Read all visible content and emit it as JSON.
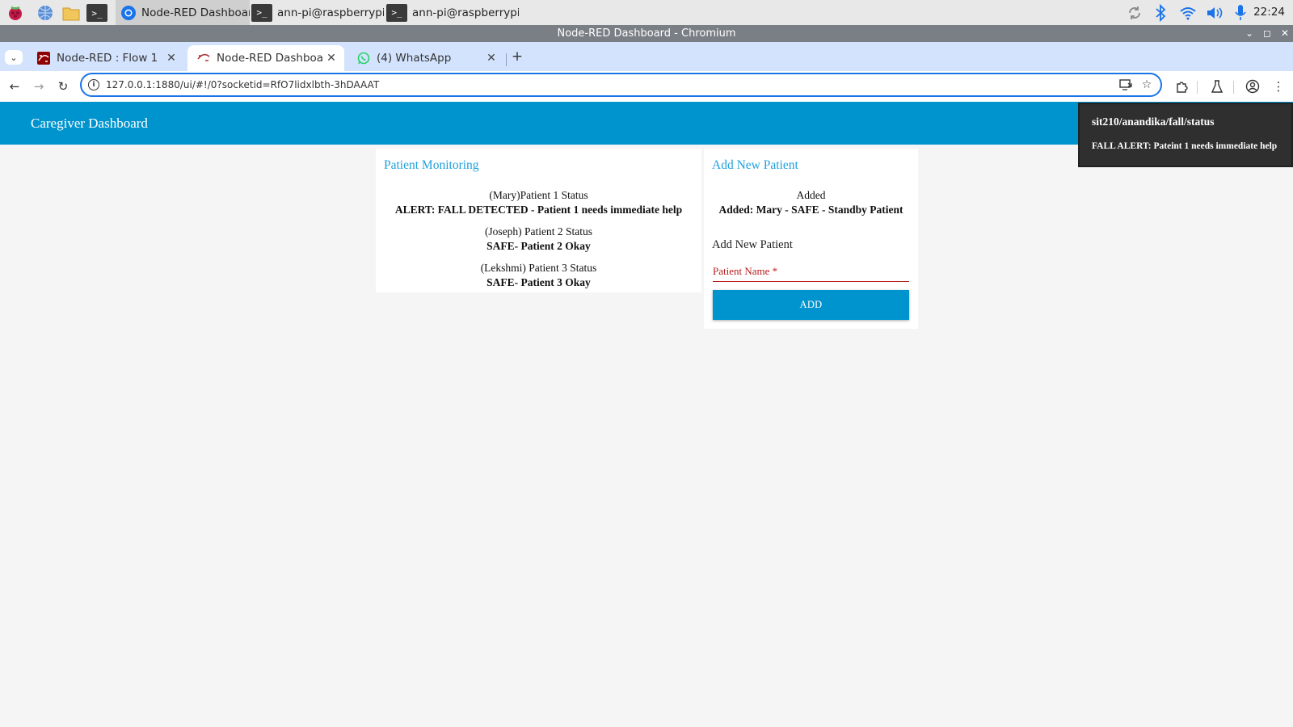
{
  "taskbar": {
    "apps": [
      {
        "label": "Node-RED Dashboar..",
        "icon": "chromium-icon"
      },
      {
        "label": "ann-pi@raspberrypi: ..",
        "icon": "terminal-icon"
      },
      {
        "label": "ann-pi@raspberrypi: .",
        "icon": "terminal-icon"
      }
    ],
    "clock": "22:24"
  },
  "window": {
    "title": "Node-RED Dashboard - Chromium"
  },
  "tabs": [
    {
      "label": "Node-RED : Flow 1",
      "icon": "node-red-icon",
      "active": false
    },
    {
      "label": "Node-RED Dashboard",
      "icon": "node-red-dashboard-icon",
      "active": true
    },
    {
      "label": "(4) WhatsApp",
      "icon": "whatsapp-icon",
      "active": false
    }
  ],
  "toolbar": {
    "url": "127.0.0.1:1880/ui/#!/0?socketid=RfO7lidxlbth-3hDAAAT"
  },
  "dashboard": {
    "title": "Caregiver Dashboard",
    "monitoring": {
      "title": "Patient Monitoring",
      "patients": [
        {
          "label": "(Mary)Patient 1 Status",
          "value": "ALERT: FALL DETECTED - Patient 1 needs immediate help"
        },
        {
          "label": "(Joseph) Patient 2 Status",
          "value": "SAFE- Patient 2 Okay"
        },
        {
          "label": "(Lekshmi) Patient 3 Status",
          "value": "SAFE- Patient 3 Okay"
        }
      ]
    },
    "add_patient": {
      "title": "Add New Patient",
      "added_label": "Added",
      "added_value": "Added: Mary - SAFE - Standby Patient",
      "form_heading": "Add New Patient",
      "input_placeholder": "Patient Name *",
      "button_label": "ADD"
    }
  },
  "toast": {
    "title": "sit210/anandika/fall/status",
    "message": "FALL ALERT: Pateint 1 needs immediate help"
  },
  "colors": {
    "header": "#0094ce",
    "card_title": "#1fa0dd",
    "input_required": "#b71c1c",
    "tab_strip": "#d3e3fd"
  }
}
